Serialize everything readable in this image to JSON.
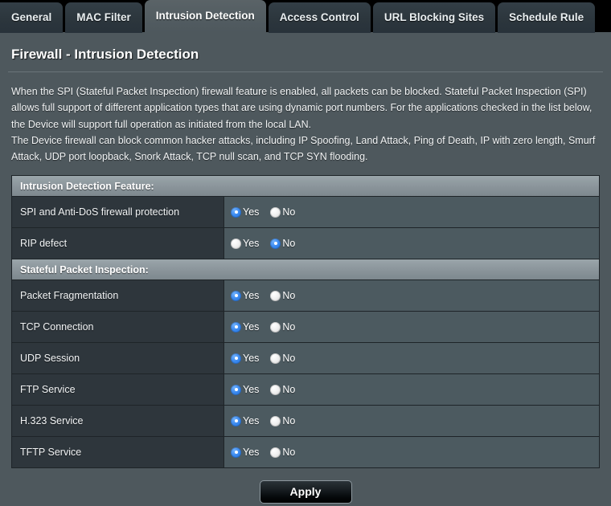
{
  "tabs": [
    {
      "label": "General",
      "active": false
    },
    {
      "label": "MAC Filter",
      "active": false
    },
    {
      "label": "Intrusion Detection",
      "active": true
    },
    {
      "label": "Access Control",
      "active": false
    },
    {
      "label": "URL Blocking Sites",
      "active": false
    },
    {
      "label": "Schedule Rule",
      "active": false
    }
  ],
  "page": {
    "title": "Firewall - Intrusion Detection",
    "description": [
      "When the SPI (Stateful Packet Inspection) firewall feature is enabled, all packets can be blocked. Stateful Packet Inspection (SPI) allows full support of different application types that are using dynamic port numbers.  For the applications checked in the list below, the Device will support full operation as initiated from the local LAN.",
      "The Device firewall can block common hacker attacks, including IP Spoofing, Land Attack, Ping of Death, IP with zero length, Smurf Attack, UDP port loopback, Snork Attack, TCP null scan, and TCP SYN flooding."
    ]
  },
  "sections": [
    {
      "header": "Intrusion Detection Feature:",
      "rows": [
        {
          "label": "SPI and Anti-DoS firewall protection",
          "yes_label": "Yes",
          "no_label": "No",
          "selected": "Yes"
        },
        {
          "label": "RIP defect",
          "yes_label": "Yes",
          "no_label": "No",
          "selected": "No"
        }
      ]
    },
    {
      "header": "Stateful Packet Inspection:",
      "rows": [
        {
          "label": "Packet Fragmentation",
          "yes_label": "Yes",
          "no_label": "No",
          "selected": "Yes"
        },
        {
          "label": "TCP Connection",
          "yes_label": "Yes",
          "no_label": "No",
          "selected": "Yes"
        },
        {
          "label": "UDP Session",
          "yes_label": "Yes",
          "no_label": "No",
          "selected": "Yes"
        },
        {
          "label": "FTP Service",
          "yes_label": "Yes",
          "no_label": "No",
          "selected": "Yes"
        },
        {
          "label": "H.323 Service",
          "yes_label": "Yes",
          "no_label": "No",
          "selected": "Yes"
        },
        {
          "label": "TFTP Service",
          "yes_label": "Yes",
          "no_label": "No",
          "selected": "Yes"
        }
      ]
    }
  ],
  "footer": {
    "apply_label": "Apply"
  },
  "colors": {
    "accent_radio": "#3d8bf0",
    "page_background": "#4e585d",
    "tab_inactive": "#2c363d",
    "tab_active": "#525c61",
    "row_label_bg": "#2e363c",
    "row_value_bg": "#4c5a60",
    "section_header_bg": "#8d979d",
    "border": "#1e2428"
  }
}
